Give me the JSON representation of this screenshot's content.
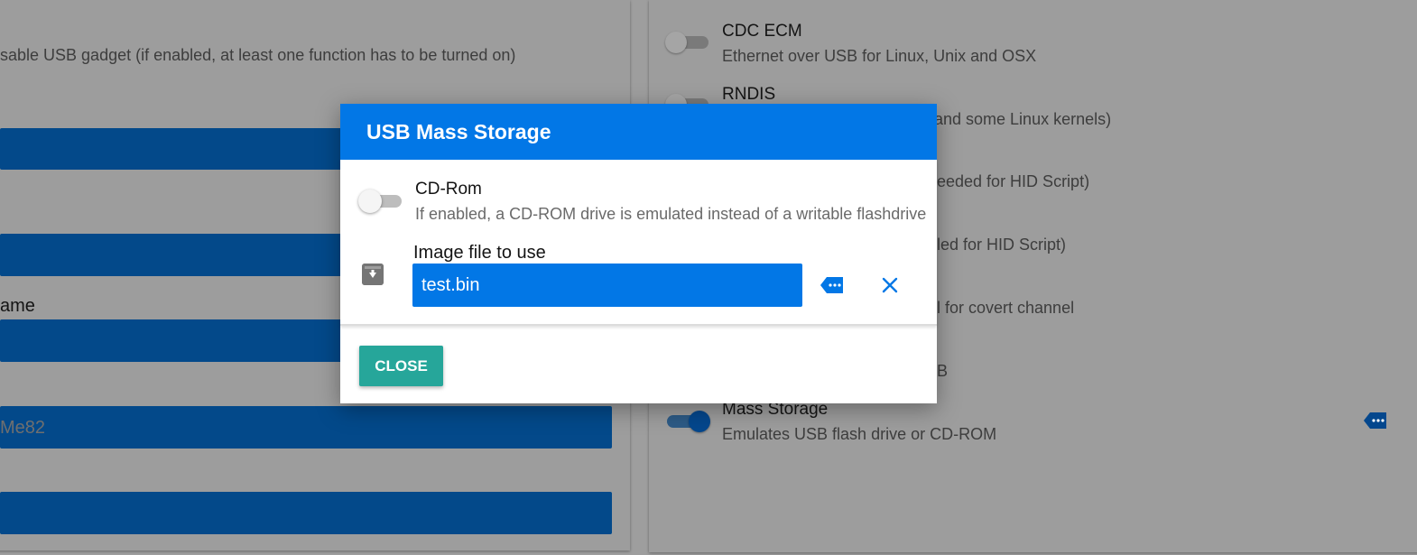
{
  "left_panel": {
    "gadget_desc": "sable USB gadget (if enabled, at least one function has to be turned on)",
    "name_label": "ame",
    "serial_value": "Me82"
  },
  "right_panel": {
    "functions": [
      {
        "title": "CDC ECM",
        "desc": "Ethernet over USB for Linux, Unix and OSX",
        "enabled": false
      },
      {
        "title": "RNDIS",
        "desc": "s (and some Linux kernels)",
        "enabled": false
      },
      {
        "title": "",
        "desc": "eeded for HID Script)"
      },
      {
        "title": "",
        "desc": "led for HID Script)"
      },
      {
        "title": "",
        "desc": "l for covert channel"
      },
      {
        "title": "",
        "desc": "B"
      },
      {
        "title": "Mass Storage",
        "desc": "Emulates USB flash drive or CD-ROM",
        "enabled": true
      }
    ]
  },
  "modal": {
    "title": "USB Mass Storage",
    "cdrom": {
      "label": "CD-Rom",
      "description": "If enabled, a CD-ROM drive is emulated instead of a writable flashdrive",
      "enabled": false
    },
    "image_file": {
      "label": "Image file to use",
      "value": "test.bin"
    },
    "close_label": "CLOSE"
  },
  "colors": {
    "modal_header": "#0277e6",
    "close_button": "#26a69a",
    "field_bar": "#03498a"
  },
  "icons": {
    "browse": "more-tag-icon",
    "clear": "close-icon",
    "file": "download-file-icon"
  }
}
